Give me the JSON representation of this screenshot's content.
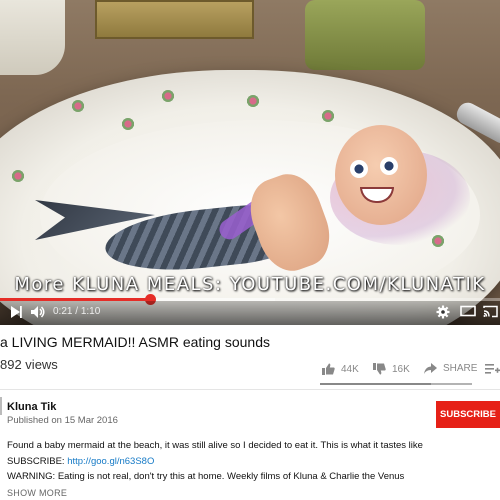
{
  "video": {
    "overlay_text": "More KLUNA  MEALS: YOUTUBE.COM/KLUNATIK",
    "current_time": "0:21",
    "duration": "1:10",
    "progress_fraction": 0.3,
    "buffered_fraction": 0.55,
    "accent_color": "#e52d27",
    "controls": {
      "play_icon": "play-icon",
      "volume_icon": "volume-icon",
      "settings_icon": "gear-icon",
      "theater_icon": "theater-mode-icon",
      "cast_icon": "cast-icon"
    }
  },
  "title": "a LIVING MERMAID!! ASMR eating sounds",
  "views": "892 views",
  "actions": {
    "likes": "44K",
    "dislikes": "16K",
    "share": "SHARE",
    "like_ratio": 0.73
  },
  "channel": {
    "name": "Kluna Tik",
    "published": "Published on 15 Mar 2016",
    "subscribe": "SUBSCRIBE",
    "subscribe_color": "#e62117"
  },
  "description": {
    "line1": "Found a baby mermaid at the beach, it was still alive so I decided to eat it. This is what it tastes like",
    "subscribe_label": "SUBSCRIBE:",
    "subscribe_link": "http://goo.gl/n63S8O",
    "line3": "WARNING: Eating is not real, don't try this at home. Weekly films of Kluna & Charlie the Venus",
    "show_more": "SHOW MORE"
  }
}
